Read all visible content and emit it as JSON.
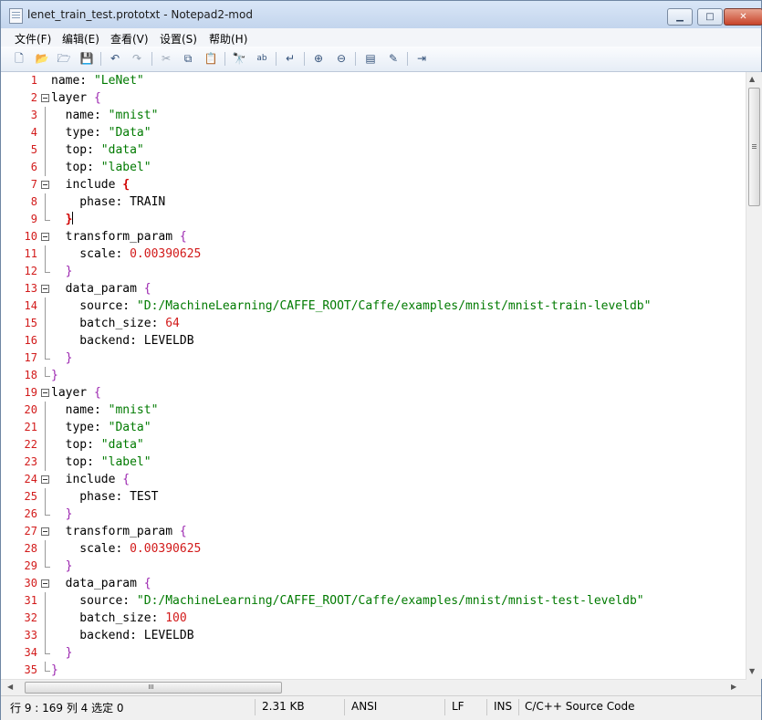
{
  "window": {
    "title": "lenet_train_test.prototxt - Notepad2-mod",
    "minimize_label": "▁",
    "maximize_label": "□",
    "close_label": "✕"
  },
  "menu": [
    "文件(F)",
    "编辑(E)",
    "查看(V)",
    "设置(S)",
    "帮助(H)"
  ],
  "toolbar": {
    "icons": [
      "new-file-icon",
      "open-file-icon",
      "browse-icon",
      "save-icon",
      "undo-icon",
      "redo-icon",
      "cut-icon",
      "copy-icon",
      "paste-icon",
      "find-icon",
      "replace-icon",
      "word-wrap-icon",
      "zoom-in-icon",
      "zoom-out-icon",
      "schemes-icon",
      "customize-icon",
      "exit-icon"
    ],
    "glyphs": [
      "🗋",
      "📂",
      "🗁",
      "💾",
      "↶",
      "↷",
      "✂",
      "⧉",
      "📋",
      "🔭",
      "ab",
      "↵",
      "⊕",
      "⊖",
      "▤",
      "✎",
      "⇥"
    ]
  },
  "editor": {
    "caret_line": 9,
    "lines": [
      {
        "n": "1",
        "fold": "none",
        "segs": [
          [
            "k",
            "name: "
          ],
          [
            "s",
            "\"LeNet\""
          ]
        ]
      },
      {
        "n": "2",
        "fold": "open",
        "segs": [
          [
            "k",
            "layer "
          ],
          [
            "b",
            "{"
          ]
        ]
      },
      {
        "n": "3",
        "fold": "line",
        "segs": [
          [
            "k",
            "  name: "
          ],
          [
            "s",
            "\"mnist\""
          ]
        ]
      },
      {
        "n": "4",
        "fold": "line",
        "segs": [
          [
            "k",
            "  type: "
          ],
          [
            "s",
            "\"Data\""
          ]
        ]
      },
      {
        "n": "5",
        "fold": "line",
        "segs": [
          [
            "k",
            "  top: "
          ],
          [
            "s",
            "\"data\""
          ]
        ]
      },
      {
        "n": "6",
        "fold": "line",
        "segs": [
          [
            "k",
            "  top: "
          ],
          [
            "s",
            "\"label\""
          ]
        ]
      },
      {
        "n": "7",
        "fold": "open",
        "segs": [
          [
            "k",
            "  include "
          ],
          [
            "bb",
            "{"
          ]
        ]
      },
      {
        "n": "8",
        "fold": "line",
        "segs": [
          [
            "k",
            "    phase: TRAIN"
          ]
        ]
      },
      {
        "n": "9",
        "fold": "end",
        "segs": [
          [
            "k",
            "  "
          ],
          [
            "bb",
            "}"
          ]
        ]
      },
      {
        "n": "10",
        "fold": "open",
        "segs": [
          [
            "k",
            "  transform_param "
          ],
          [
            "b",
            "{"
          ]
        ]
      },
      {
        "n": "11",
        "fold": "line",
        "segs": [
          [
            "k",
            "    scale: "
          ],
          [
            "n",
            "0.00390625"
          ]
        ]
      },
      {
        "n": "12",
        "fold": "end",
        "segs": [
          [
            "k",
            "  "
          ],
          [
            "b",
            "}"
          ]
        ]
      },
      {
        "n": "13",
        "fold": "open",
        "segs": [
          [
            "k",
            "  data_param "
          ],
          [
            "b",
            "{"
          ]
        ]
      },
      {
        "n": "14",
        "fold": "line",
        "segs": [
          [
            "k",
            "    source: "
          ],
          [
            "s",
            "\"D:/MachineLearning/CAFFE_ROOT/Caffe/examples/mnist/mnist-train-leveldb\""
          ]
        ]
      },
      {
        "n": "15",
        "fold": "line",
        "segs": [
          [
            "k",
            "    batch_size: "
          ],
          [
            "n",
            "64"
          ]
        ]
      },
      {
        "n": "16",
        "fold": "line",
        "segs": [
          [
            "k",
            "    backend: LEVELDB"
          ]
        ]
      },
      {
        "n": "17",
        "fold": "end",
        "segs": [
          [
            "k",
            "  "
          ],
          [
            "b",
            "}"
          ]
        ]
      },
      {
        "n": "18",
        "fold": "end",
        "segs": [
          [
            "b",
            "}"
          ]
        ]
      },
      {
        "n": "19",
        "fold": "open",
        "segs": [
          [
            "k",
            "layer "
          ],
          [
            "b",
            "{"
          ]
        ]
      },
      {
        "n": "20",
        "fold": "line",
        "segs": [
          [
            "k",
            "  name: "
          ],
          [
            "s",
            "\"mnist\""
          ]
        ]
      },
      {
        "n": "21",
        "fold": "line",
        "segs": [
          [
            "k",
            "  type: "
          ],
          [
            "s",
            "\"Data\""
          ]
        ]
      },
      {
        "n": "22",
        "fold": "line",
        "segs": [
          [
            "k",
            "  top: "
          ],
          [
            "s",
            "\"data\""
          ]
        ]
      },
      {
        "n": "23",
        "fold": "line",
        "segs": [
          [
            "k",
            "  top: "
          ],
          [
            "s",
            "\"label\""
          ]
        ]
      },
      {
        "n": "24",
        "fold": "open",
        "segs": [
          [
            "k",
            "  include "
          ],
          [
            "b",
            "{"
          ]
        ]
      },
      {
        "n": "25",
        "fold": "line",
        "segs": [
          [
            "k",
            "    phase: TEST"
          ]
        ]
      },
      {
        "n": "26",
        "fold": "end",
        "segs": [
          [
            "k",
            "  "
          ],
          [
            "b",
            "}"
          ]
        ]
      },
      {
        "n": "27",
        "fold": "open",
        "segs": [
          [
            "k",
            "  transform_param "
          ],
          [
            "b",
            "{"
          ]
        ]
      },
      {
        "n": "28",
        "fold": "line",
        "segs": [
          [
            "k",
            "    scale: "
          ],
          [
            "n",
            "0.00390625"
          ]
        ]
      },
      {
        "n": "29",
        "fold": "end",
        "segs": [
          [
            "k",
            "  "
          ],
          [
            "b",
            "}"
          ]
        ]
      },
      {
        "n": "30",
        "fold": "open",
        "segs": [
          [
            "k",
            "  data_param "
          ],
          [
            "b",
            "{"
          ]
        ]
      },
      {
        "n": "31",
        "fold": "line",
        "segs": [
          [
            "k",
            "    source: "
          ],
          [
            "s",
            "\"D:/MachineLearning/CAFFE_ROOT/Caffe/examples/mnist/mnist-test-leveldb\""
          ]
        ]
      },
      {
        "n": "32",
        "fold": "line",
        "segs": [
          [
            "k",
            "    batch_size: "
          ],
          [
            "n",
            "100"
          ]
        ]
      },
      {
        "n": "33",
        "fold": "line",
        "segs": [
          [
            "k",
            "    backend: LEVELDB"
          ]
        ]
      },
      {
        "n": "34",
        "fold": "end",
        "segs": [
          [
            "k",
            "  "
          ],
          [
            "b",
            "}"
          ]
        ]
      },
      {
        "n": "35",
        "fold": "end",
        "segs": [
          [
            "b",
            "}"
          ]
        ]
      }
    ]
  },
  "scrollbars": {
    "h_grip": "III",
    "left_arrow": "◀",
    "right_arrow": "▶",
    "up_arrow": "▲",
    "down_arrow": "▼"
  },
  "status": {
    "position": "行 9 : 169   列 4   选定 0",
    "size": "2.31 KB",
    "encoding": "ANSI",
    "eol": "LF",
    "mode": "INS",
    "lexer": "C/C++ Source Code"
  }
}
